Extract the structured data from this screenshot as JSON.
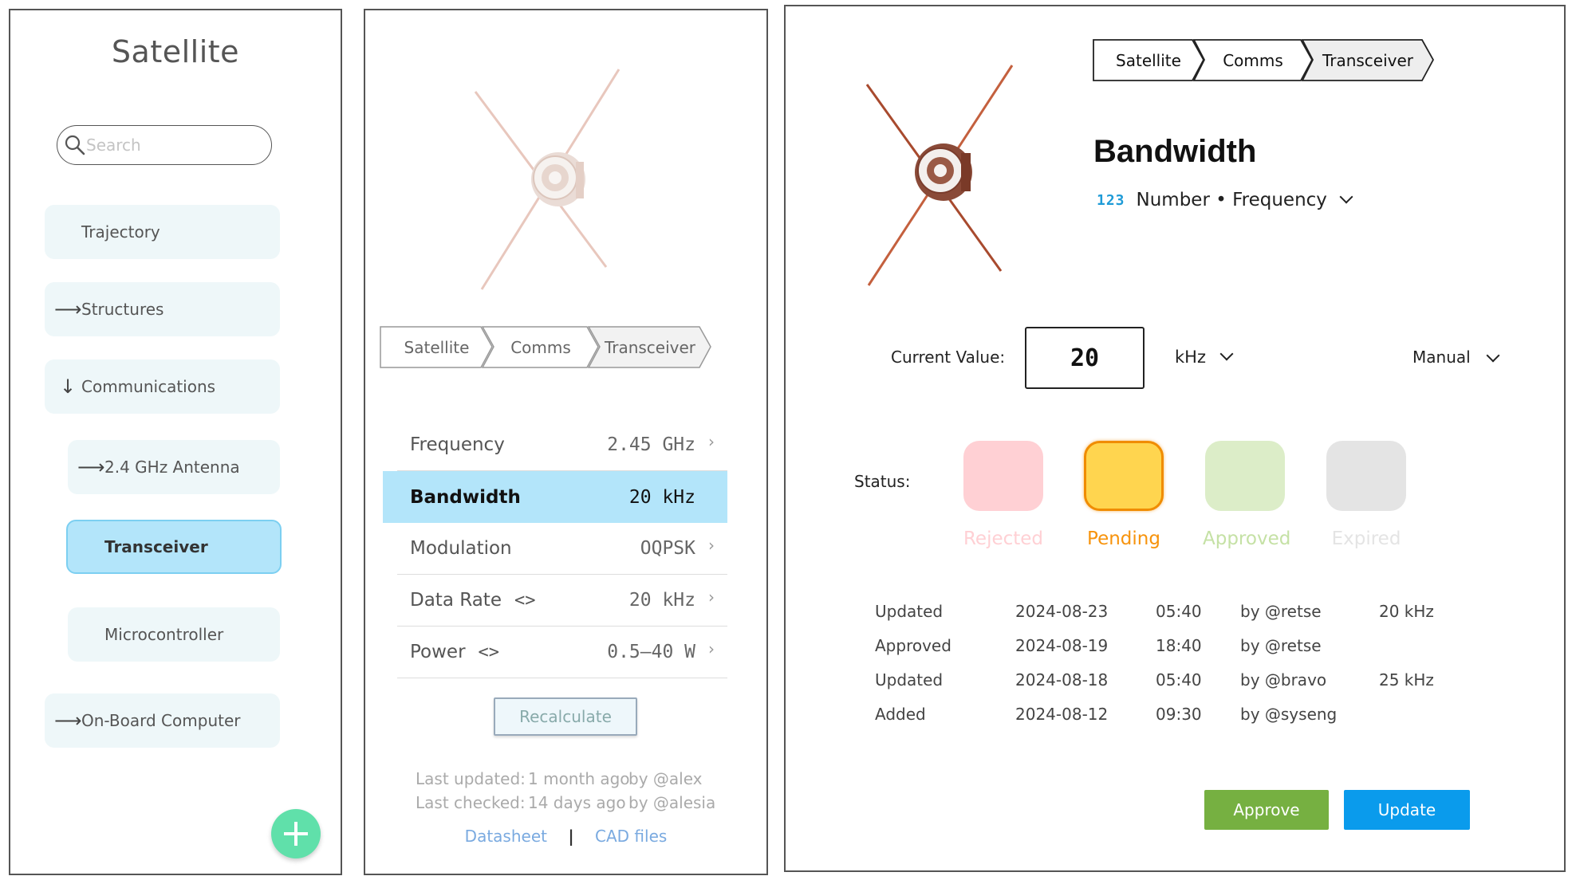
{
  "sidebar": {
    "title": "Satellite",
    "search_placeholder": "Search",
    "items": [
      {
        "label": "Trajectory",
        "arrow": ""
      },
      {
        "label": "Structures",
        "arrow": "⟶"
      },
      {
        "label": "Communications",
        "arrow": "↓"
      },
      {
        "label": "2.4 GHz Antenna",
        "arrow": "⟶"
      },
      {
        "label": "Transceiver",
        "arrow": ""
      },
      {
        "label": "Microcontroller",
        "arrow": ""
      },
      {
        "label": "On-Board Computer",
        "arrow": "⟶"
      }
    ],
    "add_icon": "plus-icon"
  },
  "detail": {
    "breadcrumb": [
      "Satellite",
      "Comms",
      "Transceiver"
    ],
    "properties": [
      {
        "name": "Frequency",
        "value": "2.45 GHz",
        "has_code": false,
        "chevron": "›"
      },
      {
        "name": "Bandwidth",
        "value": "20 kHz",
        "has_code": false,
        "chevron": ""
      },
      {
        "name": "Modulation",
        "value": "OQPSK",
        "has_code": false,
        "chevron": "›"
      },
      {
        "name": "Data Rate",
        "value": "20 kHz",
        "has_code": true,
        "chevron": "›"
      },
      {
        "name": "Power",
        "value": "0.5–40 W",
        "has_code": true,
        "chevron": "›"
      }
    ],
    "code_icon": "<>",
    "recalculate_label": "Recalculate",
    "last_updated_label": "Last updated:",
    "last_updated_when": "1 month ago",
    "last_updated_by": "by @alex",
    "last_checked_label": "Last checked:",
    "last_checked_when": "14 days ago",
    "last_checked_by": "by @alesia",
    "datasheet_link": "Datasheet",
    "separator": "|",
    "cad_link": "CAD files"
  },
  "editor": {
    "breadcrumb": [
      "Satellite",
      "Comms",
      "Transceiver"
    ],
    "title": "Bandwidth",
    "type_icon_text": "123",
    "type_label": "Number • Frequency",
    "current_value_label": "Current Value:",
    "current_value": "20",
    "unit": "kHz",
    "mode": "Manual",
    "status_label": "Status:",
    "statuses": [
      {
        "label": "Rejected",
        "color": "#ffd0d4",
        "text_color": "#ffd0d4"
      },
      {
        "label": "Pending",
        "color": "#ffd54f",
        "text_color": "#f7930c"
      },
      {
        "label": "Approved",
        "color": "#dcedc8",
        "text_color": "#c5e1a5"
      },
      {
        "label": "Expired",
        "color": "#e4e4e4",
        "text_color": "#e4e4e4"
      }
    ],
    "active_status": "Pending",
    "history": [
      {
        "action": "Updated",
        "date": "2024-08-23",
        "time": "05:40",
        "by": "by @retse",
        "value": "20 kHz"
      },
      {
        "action": "Approved",
        "date": "2024-08-19",
        "time": "18:40",
        "by": "by @retse",
        "value": ""
      },
      {
        "action": "Updated",
        "date": "2024-08-18",
        "time": "05:40",
        "by": "by @bravo",
        "value": "25 kHz"
      },
      {
        "action": "Added",
        "date": "2024-08-12",
        "time": "09:30",
        "by": "by @syseng",
        "value": ""
      }
    ],
    "approve_label": "Approve",
    "update_label": "Update"
  },
  "colors": {
    "active_nav": "#b3e5fa",
    "nav_bg": "#eef7f9",
    "fab": "#60e0aa",
    "approve": "#76b041",
    "update": "#0a9bec"
  }
}
